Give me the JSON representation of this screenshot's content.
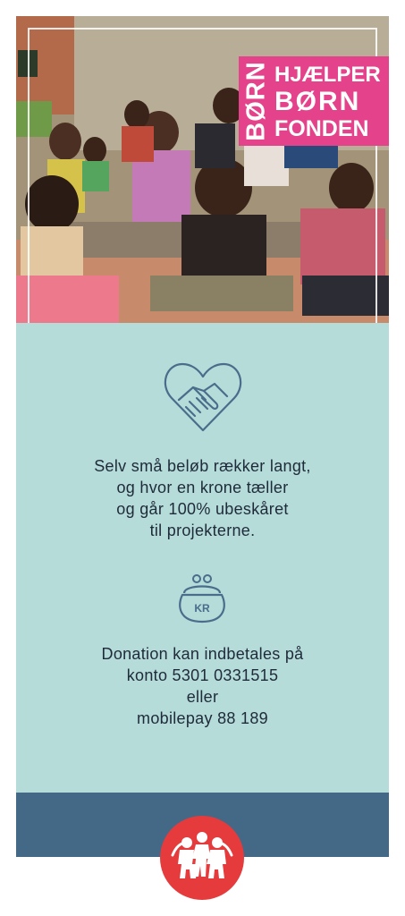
{
  "brand": {
    "vertical": "BØRN",
    "line1": "HJÆLPER",
    "line2": "BØRN",
    "line3": "FONDEN",
    "color": "#e4428a"
  },
  "message": {
    "lines": [
      "Selv små beløb rækker langt,",
      "og hvor en krone tæller",
      "og går 100% ubeskåret",
      "til projekterne."
    ]
  },
  "purse_label": "KR",
  "donation": {
    "lines": [
      "Donation kan indbetales på",
      "konto 5301 0331515",
      "eller",
      "mobilepay 88 189"
    ]
  },
  "colors": {
    "panel": "#b5dcd9",
    "footer": "#436987",
    "logo": "#e53b3c",
    "icon_stroke": "#4a6d8c"
  },
  "icons": {
    "heart": "heart-handshake-icon",
    "purse": "coin-purse-icon",
    "logo": "family-logo-icon"
  }
}
